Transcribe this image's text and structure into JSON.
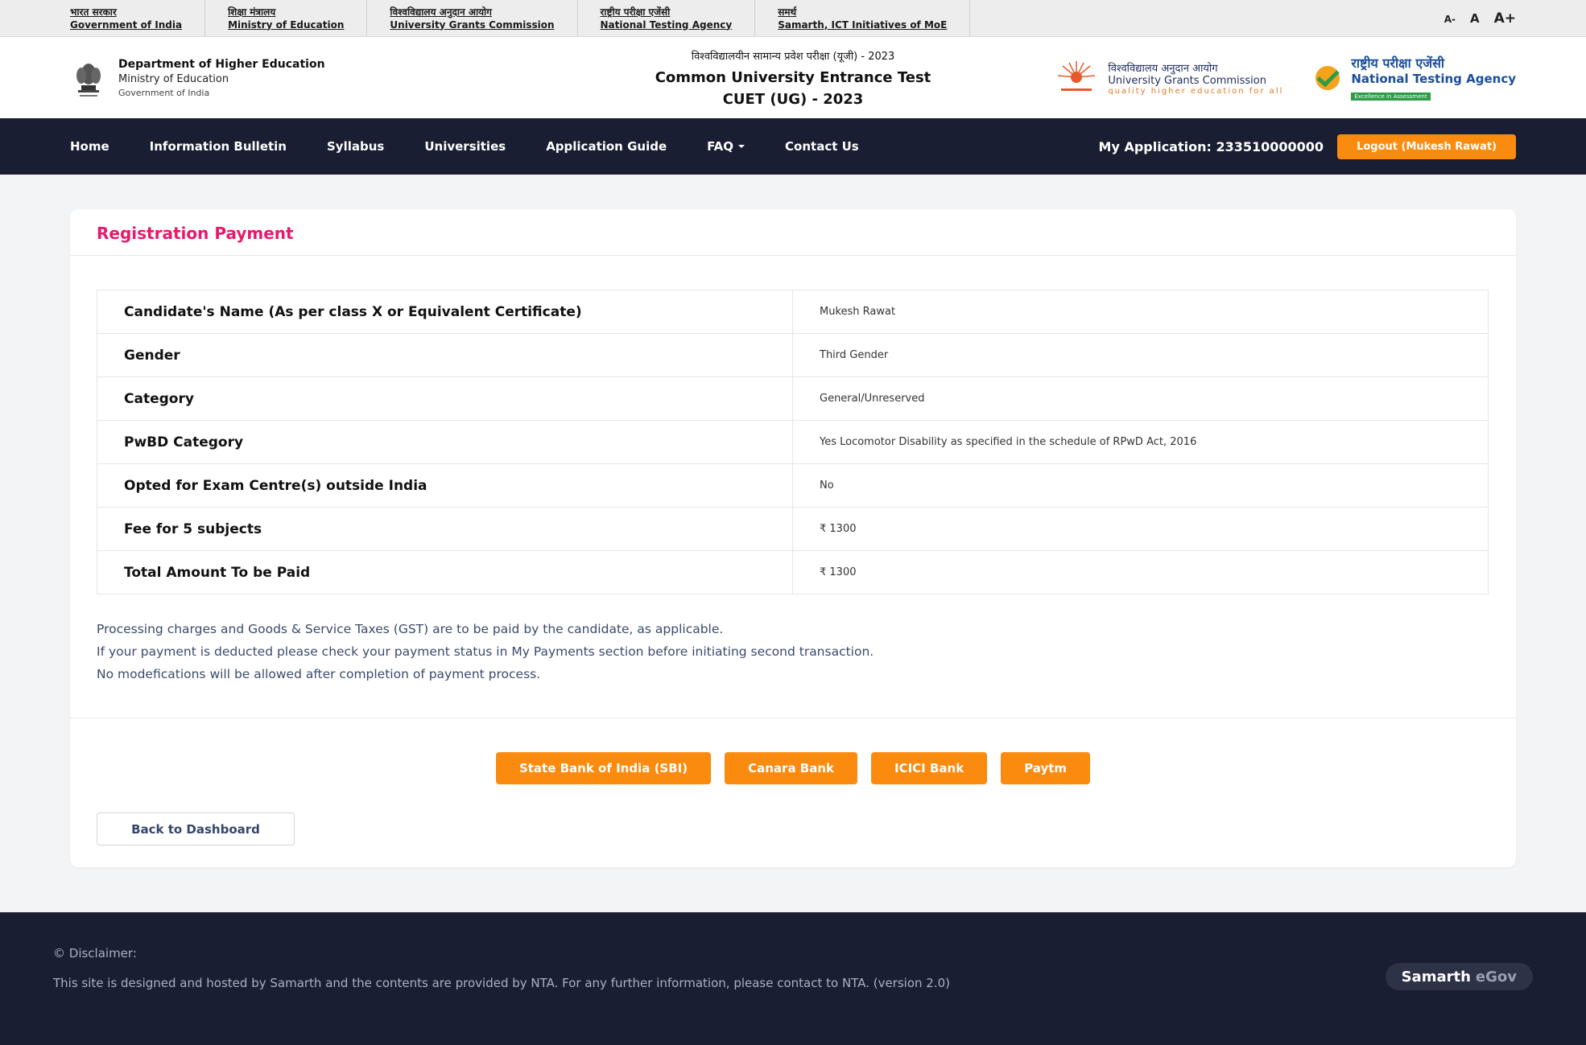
{
  "gov_strip": {
    "links": [
      {
        "hindi": "भारत सरकार",
        "english": "Government of India"
      },
      {
        "hindi": "शिक्षा मंत्रालय",
        "english": "Ministry of Education"
      },
      {
        "hindi": "विश्वविद्यालय अनुदान आयोग",
        "english": "University Grants Commission"
      },
      {
        "hindi": "राष्ट्रीय परीक्षा एजेंसी",
        "english": "National Testing Agency"
      },
      {
        "hindi": "समर्थ",
        "english": "Samarth, ICT Initiatives of MoE"
      }
    ],
    "font_sizer": {
      "decrease": "A-",
      "normal": "A",
      "increase": "A+"
    }
  },
  "header": {
    "department": {
      "line1": "Department of Higher Education",
      "line2": "Ministry of Education",
      "line3": "Government of India"
    },
    "hindi_title": "विश्वविद्यालयीन सामान्य प्रवेश परीक्षा (यूजी) - 2023",
    "title": "Common University Entrance Test",
    "subtitle": "CUET (UG) - 2023",
    "ugc": {
      "hindi": "विश्वविद्यालय अनुदान आयोग",
      "english": "University Grants Commission",
      "tagline": "quality higher education for all"
    },
    "nta": {
      "hindi": "राष्ट्रीय परीक्षा एजेंसी",
      "english": "National Testing Agency",
      "tagline": "Excellence in Assessment"
    }
  },
  "navbar": {
    "items": [
      "Home",
      "Information Bulletin",
      "Syllabus",
      "Universities",
      "Application Guide",
      "FAQ",
      "Contact Us"
    ],
    "my_application": "My Application: 233510000000",
    "logout": "Logout (Mukesh Rawat)"
  },
  "card": {
    "title": "Registration Payment",
    "rows": [
      {
        "label": "Candidate's Name (As per class X or Equivalent Certificate)",
        "value": "Mukesh Rawat"
      },
      {
        "label": "Gender",
        "value": "Third Gender"
      },
      {
        "label": "Category",
        "value": "General/Unreserved"
      },
      {
        "label": "PwBD Category",
        "value": "Yes Locomotor Disability as specified in the schedule of RPwD Act, 2016"
      },
      {
        "label": "Opted for Exam Centre(s) outside India",
        "value": "No"
      },
      {
        "label": "Fee for 5 subjects",
        "value": "₹ 1300"
      },
      {
        "label": "Total Amount To be Paid",
        "value": "₹ 1300"
      }
    ],
    "notes": [
      "Processing charges and Goods & Service Taxes (GST) are to be paid by the candidate, as applicable.",
      "If your payment is deducted please check your payment status in My Payments section before initiating second transaction.",
      "No modefications will be allowed after completion of payment process."
    ],
    "payment_buttons": [
      "State Bank of India (SBI)",
      "Canara Bank",
      "ICICI Bank",
      "Paytm"
    ],
    "back_button": "Back to Dashboard"
  },
  "footer": {
    "title": "© Disclaimer:",
    "text": "This site is designed and hosted by Samarth and the contents are provided by NTA. For any further information, please contact to NTA. (version 2.0)",
    "badge_part1": "Samarth",
    "badge_part2": "eGov"
  },
  "colors": {
    "navbar_bg": "#1a1e33",
    "accent_orange": "#fb8b0e",
    "title_pink": "#e8196b"
  },
  "icons": [
    "govt-emblem-icon",
    "ugc-logo-icon",
    "nta-logo-icon",
    "chevron-down-icon"
  ]
}
